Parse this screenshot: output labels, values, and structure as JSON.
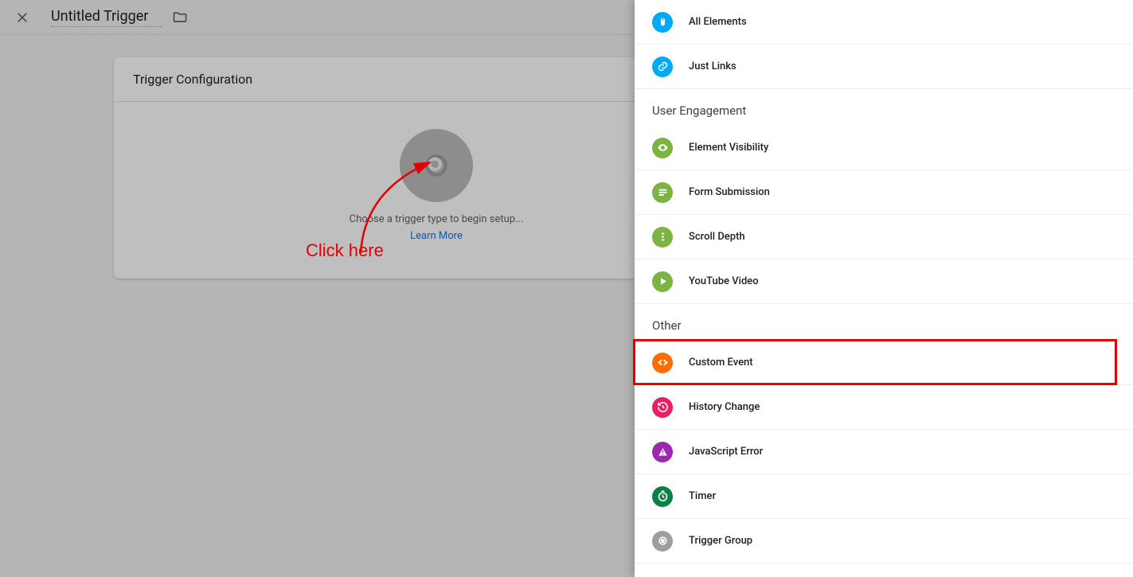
{
  "header": {
    "title": "Untitled Trigger"
  },
  "card": {
    "heading": "Trigger Configuration",
    "choose_text": "Choose a trigger type to begin setup...",
    "learn_more": "Learn More"
  },
  "annotation": {
    "text": "Click here"
  },
  "panel": {
    "groups": [
      {
        "items": [
          {
            "label": "All Elements",
            "icon": "mouse-icon",
            "color": "ic-blue"
          },
          {
            "label": "Just Links",
            "icon": "link-icon",
            "color": "ic-blue"
          }
        ]
      },
      {
        "heading": "User Engagement",
        "items": [
          {
            "label": "Element Visibility",
            "icon": "eye-icon",
            "color": "ic-green"
          },
          {
            "label": "Form Submission",
            "icon": "form-icon",
            "color": "ic-green"
          },
          {
            "label": "Scroll Depth",
            "icon": "scroll-icon",
            "color": "ic-green"
          },
          {
            "label": "YouTube Video",
            "icon": "play-icon",
            "color": "ic-green"
          }
        ]
      },
      {
        "heading": "Other",
        "items": [
          {
            "label": "Custom Event",
            "icon": "code-icon",
            "color": "ic-orange",
            "highlighted": true
          },
          {
            "label": "History Change",
            "icon": "history-icon",
            "color": "ic-pink"
          },
          {
            "label": "JavaScript Error",
            "icon": "warning-icon",
            "color": "ic-purple"
          },
          {
            "label": "Timer",
            "icon": "timer-icon",
            "color": "ic-darkgreen"
          },
          {
            "label": "Trigger Group",
            "icon": "group-icon",
            "color": "ic-gray"
          }
        ]
      }
    ]
  }
}
